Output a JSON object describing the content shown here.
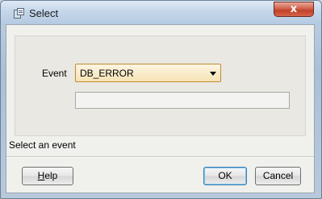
{
  "window": {
    "title": "Select",
    "close_glyph": "x"
  },
  "form": {
    "event_label": "Event",
    "event_value": "DB_ERROR",
    "description": ""
  },
  "status_text": "Select an event",
  "buttons": {
    "help_mnemonic": "H",
    "help_rest": "elp",
    "ok": "OK",
    "cancel": "Cancel"
  },
  "icons": {
    "app": "select-dialog-icon",
    "close": "close-icon",
    "dropdown": "chevron-down-icon"
  },
  "colors": {
    "titlebar": "#c4d6ea",
    "close": "#c2412a",
    "select_bg": "#f6e3b5",
    "select_border": "#c08a2c",
    "dialog_bg": "#f0f0ed"
  }
}
